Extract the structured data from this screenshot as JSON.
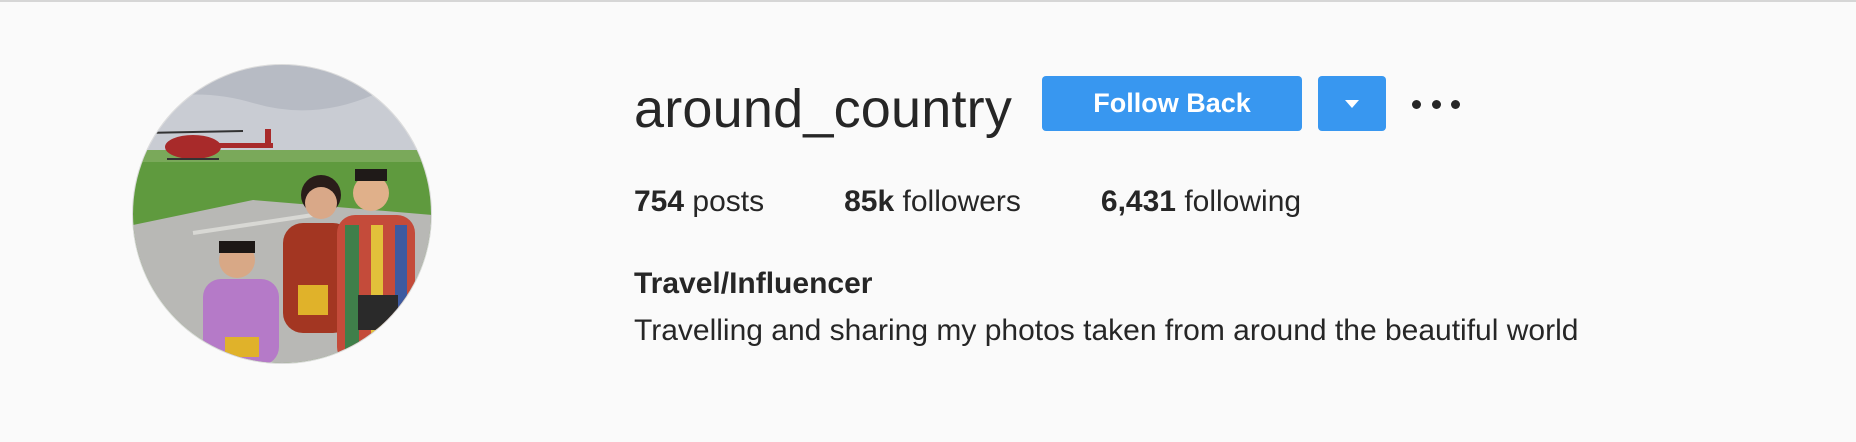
{
  "profile": {
    "username": "around_country",
    "avatar_icon": "profile-photo-family-helicopter",
    "actions": {
      "follow_label": "Follow Back",
      "dropdown_icon": "caret-down-icon",
      "more_icon": "more-options-icon"
    },
    "stats": {
      "posts_count": "754",
      "posts_label": "posts",
      "followers_count": "85k",
      "followers_label": "followers",
      "following_count": "6,431",
      "following_label": "following"
    },
    "bio": {
      "category": "Travel/Influencer",
      "text": "Travelling and sharing my photos taken from around the beautiful world"
    }
  },
  "colors": {
    "accent": "#3897f0",
    "text": "#262626",
    "background": "#fafafa"
  }
}
